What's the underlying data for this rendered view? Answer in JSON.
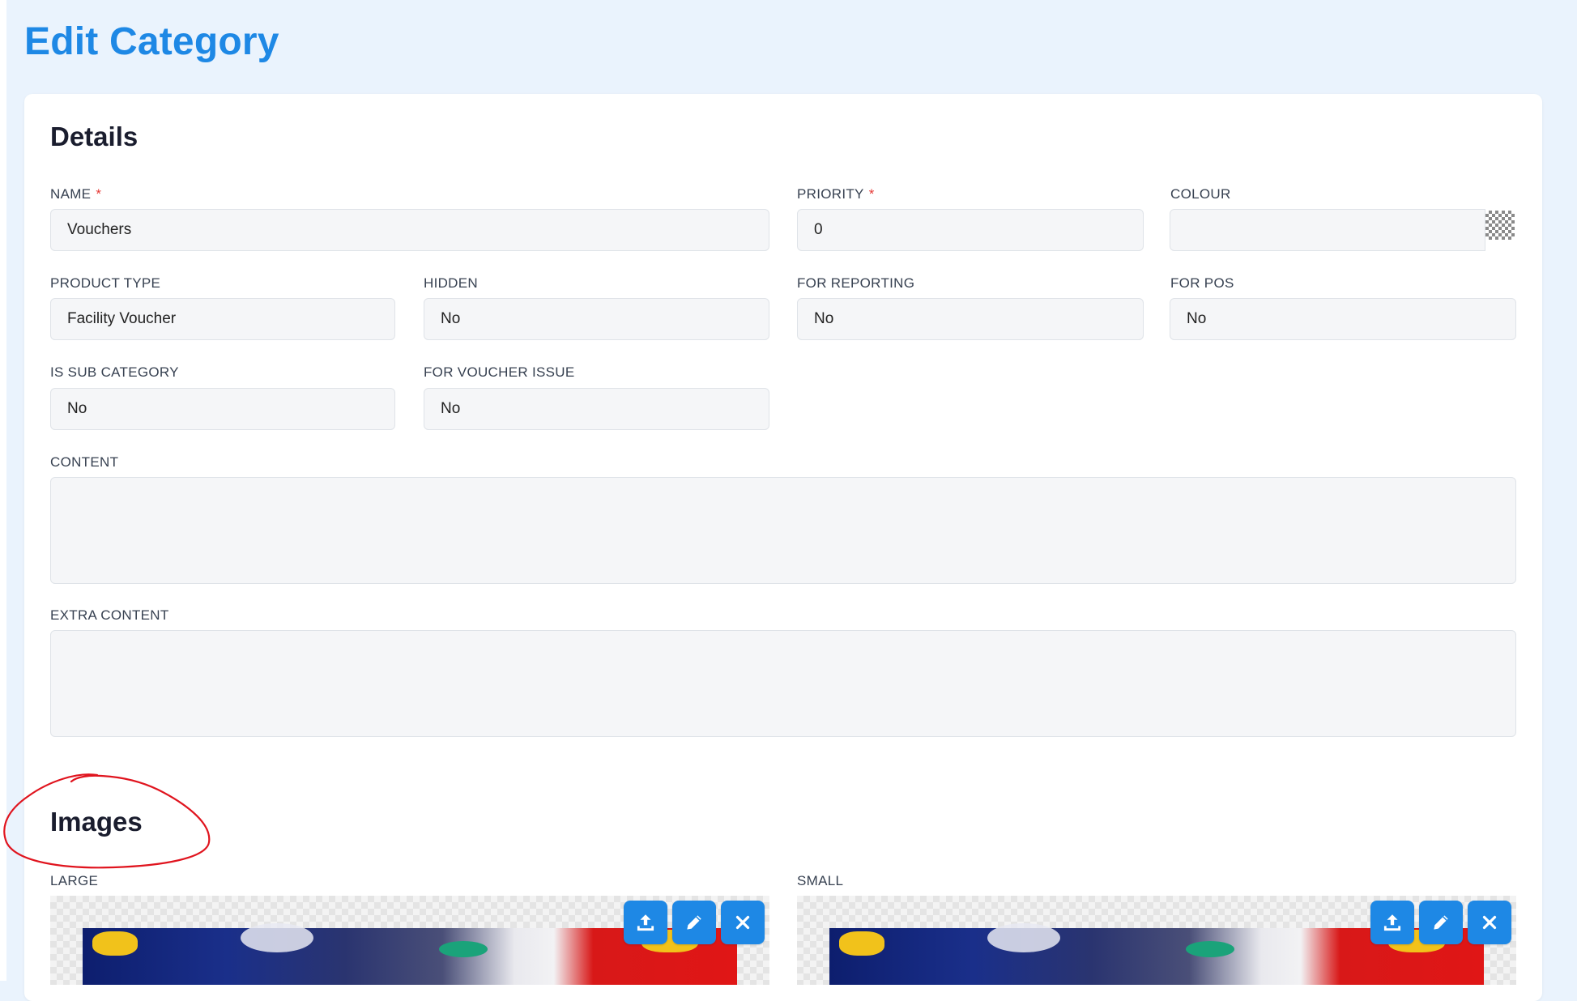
{
  "page": {
    "title": "Edit Category"
  },
  "details": {
    "heading": "Details",
    "name": {
      "label": "NAME",
      "required_mark": "*",
      "value": "Vouchers"
    },
    "priority": {
      "label": "PRIORITY",
      "required_mark": "*",
      "value": "0"
    },
    "colour": {
      "label": "COLOUR",
      "value": ""
    },
    "product_type": {
      "label": "PRODUCT TYPE",
      "value": "Facility Voucher"
    },
    "hidden": {
      "label": "HIDDEN",
      "value": "No"
    },
    "for_reporting": {
      "label": "FOR REPORTING",
      "value": "No"
    },
    "for_pos": {
      "label": "FOR POS",
      "value": "No"
    },
    "is_sub_category": {
      "label": "IS SUB CATEGORY",
      "value": "No"
    },
    "for_voucher_issue": {
      "label": "FOR VOUCHER ISSUE",
      "value": "No"
    },
    "content": {
      "label": "CONTENT",
      "value": ""
    },
    "extra_content": {
      "label": "EXTRA CONTENT",
      "value": ""
    }
  },
  "images": {
    "heading": "Images",
    "large": {
      "label": "LARGE"
    },
    "small": {
      "label": "SMALL"
    },
    "buttons": [
      "upload-icon",
      "pencil-icon",
      "close-icon"
    ]
  },
  "colors": {
    "accent": "#1e88e5",
    "page_bg": "#eaf3fd",
    "required": "#e53935",
    "annotation": "#e0141e"
  }
}
